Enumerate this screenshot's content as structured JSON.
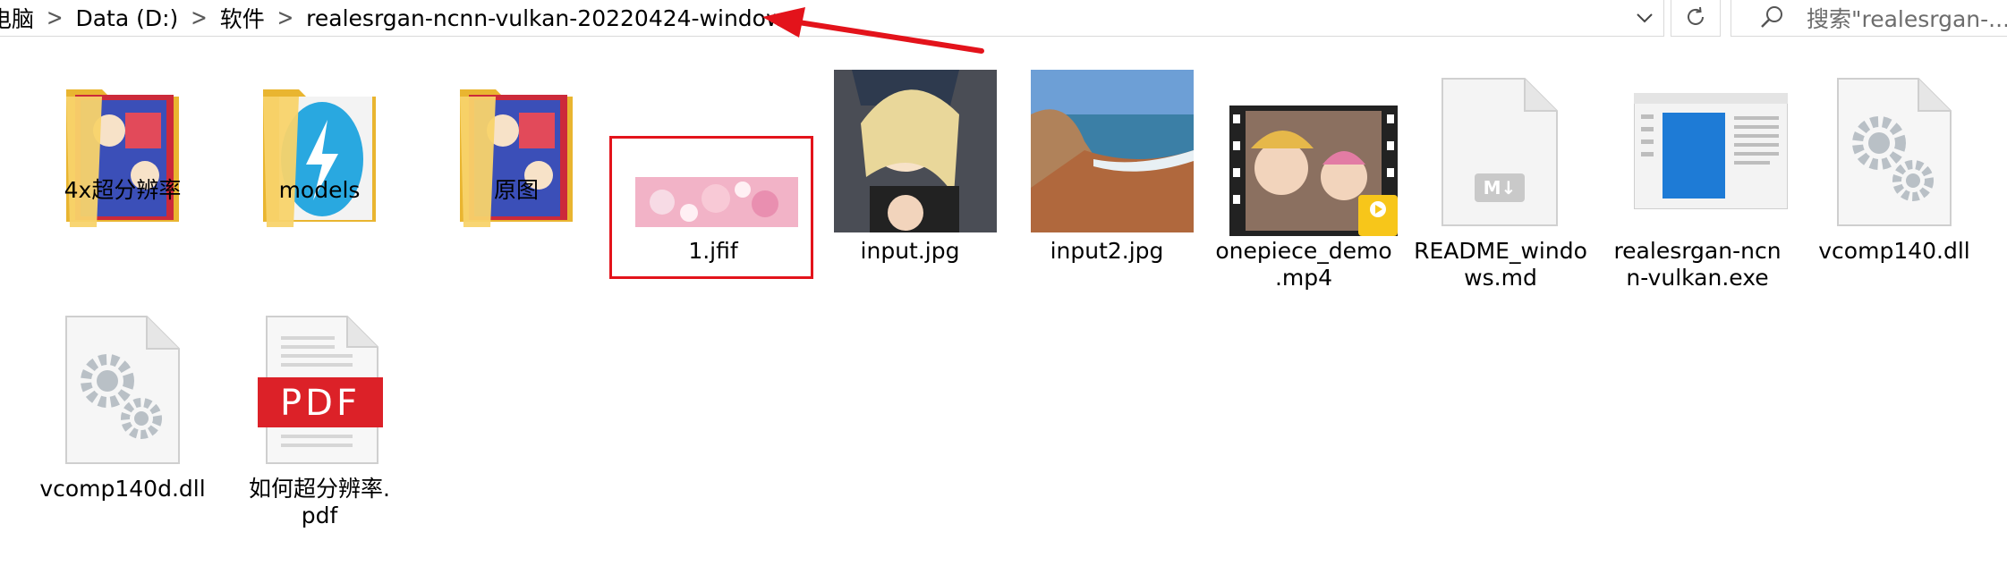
{
  "address_bar": {
    "breadcrumbs": [
      "电脑",
      "Data (D:)",
      "软件",
      "realesrgan-ncnn-vulkan-20220424-windows"
    ],
    "search_placeholder": "搜索\"realesrgan-..."
  },
  "colors": {
    "annotation": "#e3131b",
    "folder": "#f5c542"
  },
  "files": [
    {
      "name": "4x超分辨率",
      "type": "folder",
      "icon": "folder-icon"
    },
    {
      "name": "models",
      "type": "folder",
      "icon": "folder-icon"
    },
    {
      "name": "原图",
      "type": "folder",
      "icon": "folder-icon"
    },
    {
      "name": "1.jfif",
      "type": "image",
      "icon": "image-thumbnail",
      "selected": true
    },
    {
      "name": "input.jpg",
      "type": "image",
      "icon": "image-thumbnail"
    },
    {
      "name": "input2.jpg",
      "type": "image",
      "icon": "image-thumbnail"
    },
    {
      "name": "onepiece_demo.mp4",
      "lines": [
        "onepiece_demo",
        ".mp4"
      ],
      "type": "video",
      "icon": "video-thumbnail",
      "badge": "Player"
    },
    {
      "name": "README_windows.md",
      "lines": [
        "README_windo",
        "ws.md"
      ],
      "type": "markdown",
      "icon": "markdown-file-icon",
      "badge": "M↓"
    },
    {
      "name": "realesrgan-ncnn-vulkan.exe",
      "lines": [
        "realesrgan-ncn",
        "n-vulkan.exe"
      ],
      "type": "exe",
      "icon": "application-icon"
    },
    {
      "name": "vcomp140.dll",
      "type": "dll",
      "icon": "gear-file-icon"
    },
    {
      "name": "vcomp140d.dll",
      "type": "dll",
      "icon": "gear-file-icon"
    },
    {
      "name": "如何超分辨率.pdf",
      "lines": [
        "如何超分辨率.",
        "pdf"
      ],
      "type": "pdf",
      "icon": "pdf-file-icon",
      "badge": "PDF"
    }
  ]
}
